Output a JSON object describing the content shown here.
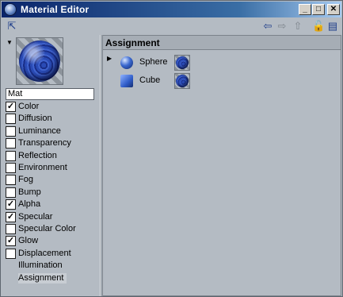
{
  "window": {
    "title": "Material Editor",
    "buttons": {
      "minimize": "_",
      "maximize": "□",
      "close": "✕"
    }
  },
  "toolbar": {
    "icons": [
      "pin-icon",
      "back-arrow-icon",
      "forward-arrow-icon",
      "up-arrow-icon",
      "lock-icon",
      "layout-icon"
    ]
  },
  "material": {
    "name": "Mat"
  },
  "channels": [
    {
      "label": "Color",
      "checked": true
    },
    {
      "label": "Diffusion",
      "checked": false
    },
    {
      "label": "Luminance",
      "checked": false
    },
    {
      "label": "Transparency",
      "checked": false
    },
    {
      "label": "Reflection",
      "checked": false
    },
    {
      "label": "Environment",
      "checked": false
    },
    {
      "label": "Fog",
      "checked": false
    },
    {
      "label": "Bump",
      "checked": false
    },
    {
      "label": "Alpha",
      "checked": true
    },
    {
      "label": "Specular",
      "checked": true
    },
    {
      "label": "Specular Color",
      "checked": false
    },
    {
      "label": "Glow",
      "checked": true
    },
    {
      "label": "Displacement",
      "checked": false
    }
  ],
  "extra_items": [
    {
      "label": "Illumination"
    },
    {
      "label": "Assignment",
      "selected": true
    }
  ],
  "assignment": {
    "header": "Assignment",
    "objects": [
      {
        "name": "Sphere",
        "icon": "sphere-icon"
      },
      {
        "name": "Cube",
        "icon": "cube-icon"
      }
    ]
  },
  "colors": {
    "title_bar": "#0a246a",
    "panel_bg": "#b4bbc3",
    "material_blue": "#2a4bb5"
  }
}
